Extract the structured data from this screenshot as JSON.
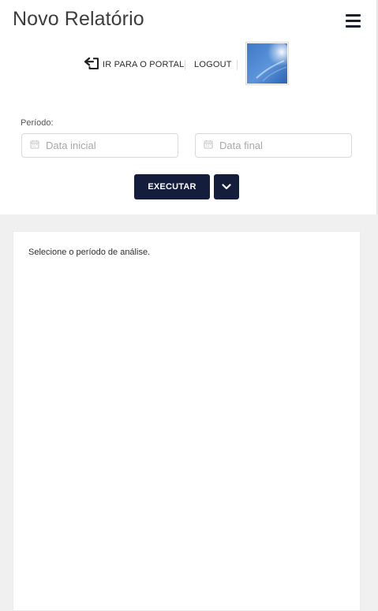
{
  "header": {
    "title": "Novo Relatório",
    "menu_icon": "hamburger-menu-icon"
  },
  "nav": {
    "portal_label": "IR PARA O PORTAL",
    "portal_icon": "return-arrow-icon",
    "logout_label": "LOGOUT"
  },
  "form": {
    "period_label": "Período:",
    "start_date": {
      "placeholder": "Data inicial",
      "value": "",
      "icon": "calendar-icon"
    },
    "end_date": {
      "placeholder": "Data final",
      "value": "",
      "icon": "calendar-icon"
    },
    "execute_label": "EXECUTAR",
    "dropdown_icon": "chevron-down-icon"
  },
  "results": {
    "message": "Selecione o período de análise."
  },
  "colors": {
    "primary": "#141e3c",
    "page_background": "#f0f0f0",
    "panel_background": "#ffffff",
    "title_text": "#3d3d3d",
    "placeholder_text": "#a8a8a8"
  }
}
